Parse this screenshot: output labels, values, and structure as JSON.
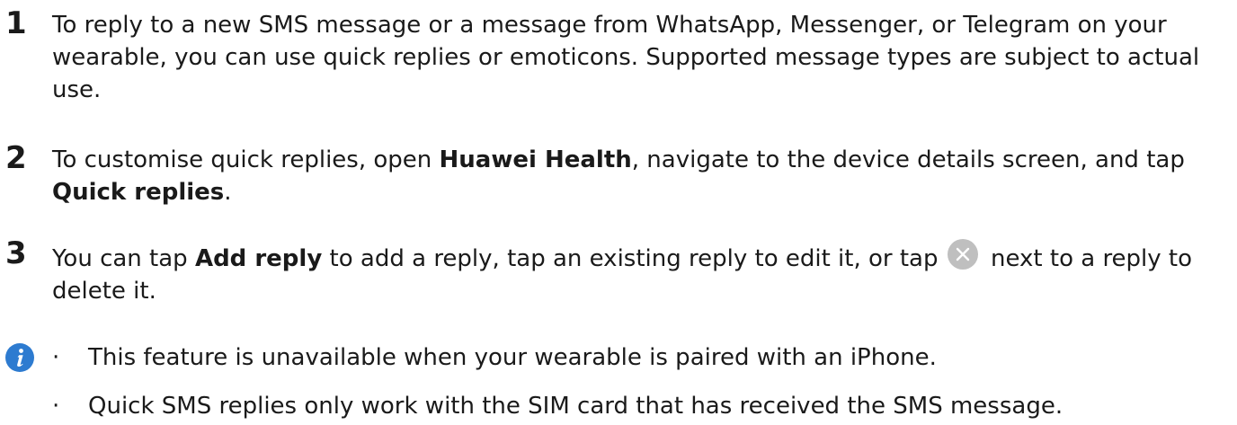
{
  "steps": [
    {
      "number": "1",
      "segments": [
        {
          "text": "To reply to a new SMS message or a message from WhatsApp, Messenger, or Telegram on your wearable, you can use quick replies or emoticons. Supported message types are subject to actual use.",
          "bold": false
        }
      ]
    },
    {
      "number": "2",
      "segments": [
        {
          "text": "To customise quick replies, open ",
          "bold": false
        },
        {
          "text": "Huawei Health",
          "bold": true
        },
        {
          "text": ", navigate to the device details screen, and tap ",
          "bold": false
        },
        {
          "text": "Quick replies",
          "bold": true
        },
        {
          "text": ".",
          "bold": false
        }
      ]
    },
    {
      "number": "3",
      "segments": [
        {
          "text": "You can tap ",
          "bold": false
        },
        {
          "text": "Add reply",
          "bold": true
        },
        {
          "text": " to add a reply, tap an existing reply to edit it, or tap ",
          "bold": false
        },
        {
          "icon": "close-icon"
        },
        {
          "text": " next to a reply to delete it.",
          "bold": false
        }
      ]
    }
  ],
  "note": {
    "icon": "info-icon",
    "bullets": [
      "This feature is unavailable when your wearable is paired with an iPhone.",
      "Quick SMS replies only work with the SIM card that has received the SMS message."
    ],
    "bullet_char": "·"
  },
  "colors": {
    "text": "#1a1a1a",
    "info_icon": "#2d7bd0",
    "close_icon": "#bfbfbf"
  }
}
